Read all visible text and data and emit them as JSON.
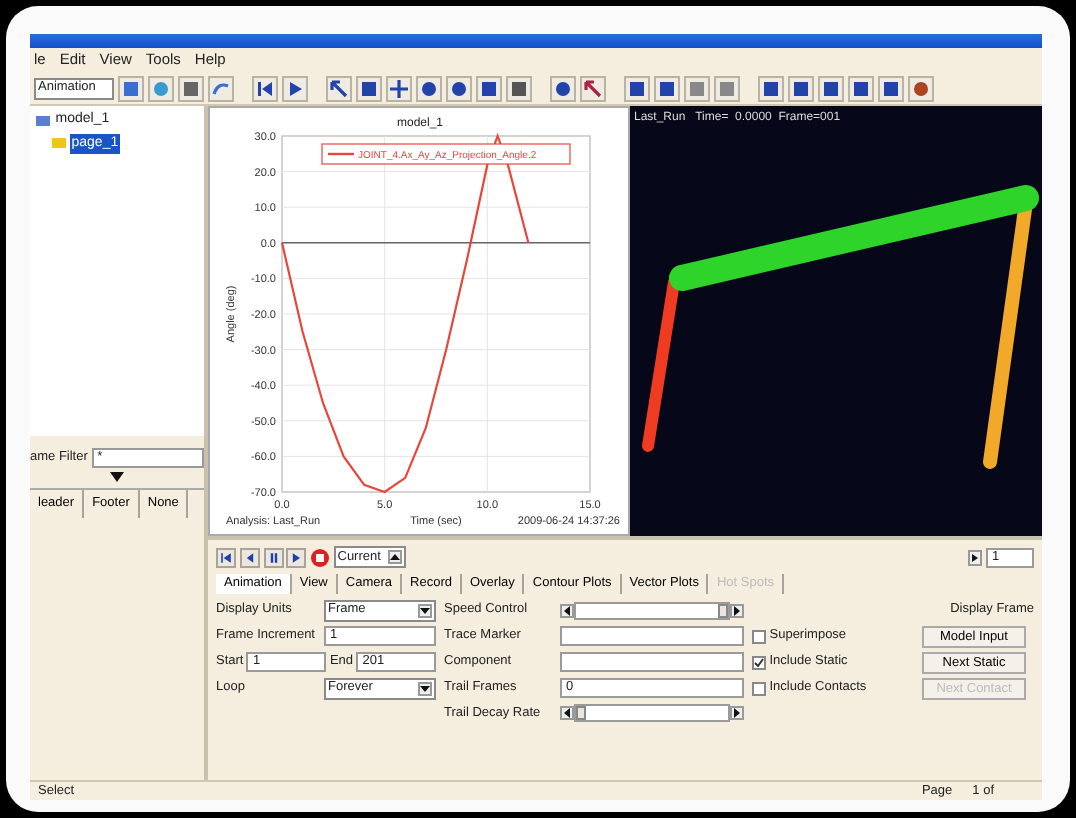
{
  "menu": [
    "le",
    "Edit",
    "View",
    "Tools",
    "Help"
  ],
  "toolbar": {
    "mode": "Animation"
  },
  "tree": [
    {
      "label": "model_1",
      "selected": false,
      "children": [
        {
          "label": "page_1",
          "selected": true
        }
      ]
    }
  ],
  "filter": {
    "label": "ame Filter",
    "value": "*"
  },
  "left_tabs": [
    {
      "label": "leader",
      "selected": false
    },
    {
      "label": "Footer",
      "selected": false
    },
    {
      "label": "None",
      "selected": false
    }
  ],
  "plot": {
    "chart_data": {
      "type": "line",
      "title": "model_1",
      "xlabel": "Time (sec)",
      "ylabel": "Angle (deg)",
      "xlim": [
        0,
        15
      ],
      "ylim": [
        -70,
        30
      ],
      "grid": true,
      "xticks": [
        {
          "value": 0,
          "label": "0.0"
        },
        {
          "value": 5,
          "label": "5.0"
        },
        {
          "value": 10,
          "label": "10.0"
        },
        {
          "value": 15,
          "label": "15.0"
        }
      ],
      "yticks": [
        {
          "value": 30,
          "label": "30.0"
        },
        {
          "value": 20,
          "label": "20.0"
        },
        {
          "value": 10,
          "label": "10.0"
        },
        {
          "value": 0,
          "label": "0.0"
        },
        {
          "value": -10,
          "label": "-10.0"
        },
        {
          "value": -20,
          "label": "-20.0"
        },
        {
          "value": -30,
          "label": "-30.0"
        },
        {
          "value": -40,
          "label": "-40.0"
        },
        {
          "value": -50,
          "label": "-50.0"
        },
        {
          "value": -60,
          "label": "-60.0"
        },
        {
          "value": -70,
          "label": "-70.0"
        }
      ],
      "x": [
        0,
        1,
        2,
        3,
        4,
        5,
        6,
        7,
        8,
        9,
        10,
        10.5,
        11,
        12
      ],
      "series": [
        {
          "name": "JOINT_4.Ax_Ay_Az_Projection_Angle.2",
          "color": "#e8463a",
          "values": [
            0,
            -25,
            -45,
            -60,
            -68,
            -70,
            -66,
            -52,
            -30,
            -5,
            22,
            30,
            22,
            0
          ]
        }
      ]
    },
    "analysis": "Analysis:  Last_Run",
    "timestamp": "2009-06-24 14:37:26"
  },
  "viewer": {
    "caption": "Last_Run   Time=  0.0000  Frame=001"
  },
  "playback": {
    "current": "Current",
    "frame": "1"
  },
  "tabs": [
    {
      "label": "Animation",
      "selected": true,
      "disabled": false
    },
    {
      "label": "View",
      "selected": false,
      "disabled": false
    },
    {
      "label": "Camera",
      "selected": false,
      "disabled": false
    },
    {
      "label": "Record",
      "selected": false,
      "disabled": false
    },
    {
      "label": "Overlay",
      "selected": false,
      "disabled": false
    },
    {
      "label": "Contour Plots",
      "selected": false,
      "disabled": false
    },
    {
      "label": "Vector Plots",
      "selected": false,
      "disabled": false
    },
    {
      "label": "Hot Spots",
      "selected": false,
      "disabled": true
    }
  ],
  "form": {
    "display_units": {
      "label": "Display Units",
      "value": "Frame"
    },
    "frame_increment": {
      "label": "Frame Increment",
      "value": "1"
    },
    "start": {
      "label": "Start",
      "value": "1"
    },
    "end": {
      "label": "End",
      "value": "201"
    },
    "loop": {
      "label": "Loop",
      "value": "Forever"
    },
    "speed_control": {
      "label": "Speed Control",
      "level": 1
    },
    "trace_marker": {
      "label": "Trace Marker"
    },
    "component": {
      "label": "Component"
    },
    "trail_frames": {
      "label": "Trail Frames",
      "value": "0"
    },
    "trail_decay_rate": {
      "label": "Trail Decay Rate",
      "level": 0
    }
  },
  "checks": [
    {
      "label": "Superimpose",
      "checked": false
    },
    {
      "label": "Include Static",
      "checked": true
    },
    {
      "label": "Include Contacts",
      "checked": false
    }
  ],
  "display_frame": {
    "label": "Display Frame",
    "buttons": [
      {
        "label": "Model Input",
        "disabled": false
      },
      {
        "label": "Next Static",
        "disabled": false
      },
      {
        "label": "Next Contact",
        "disabled": true
      }
    ]
  },
  "status_bar": {
    "left": "Select",
    "page": "Page",
    "count": "1 of"
  }
}
